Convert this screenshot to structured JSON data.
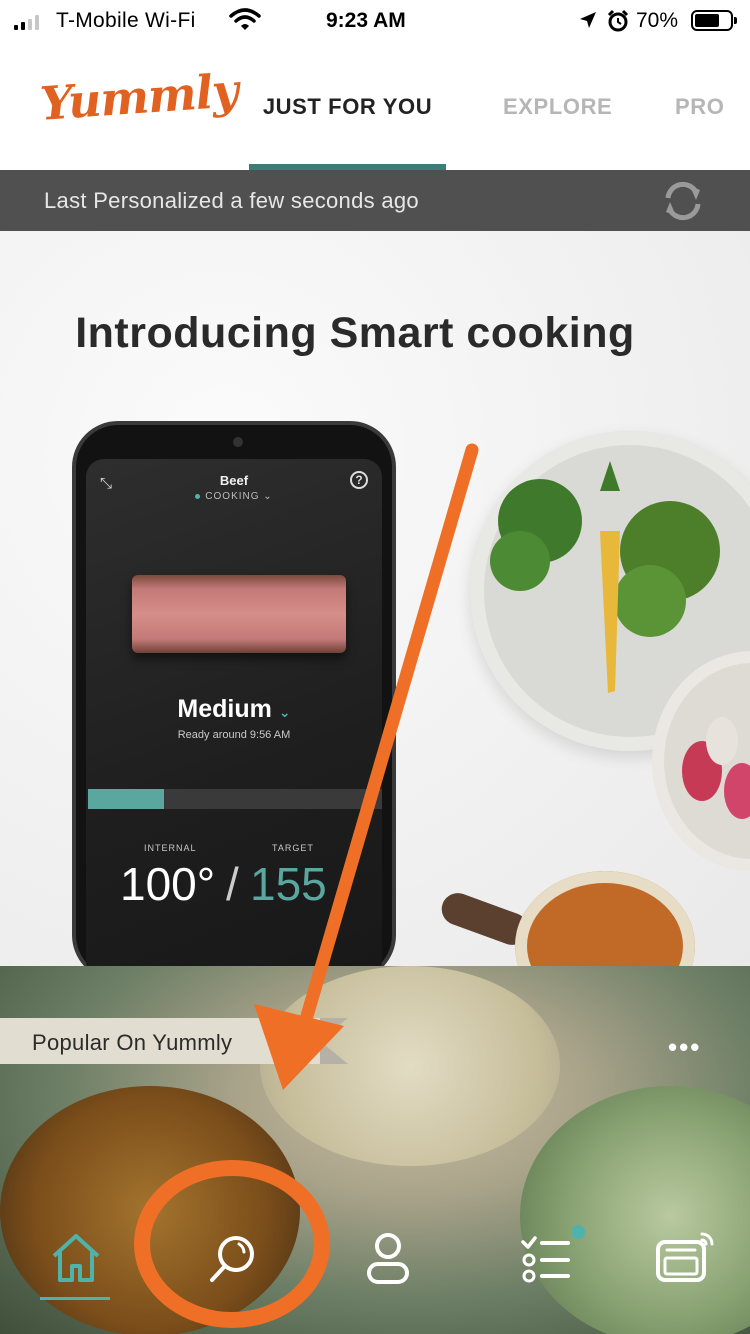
{
  "status_bar": {
    "carrier": "T-Mobile Wi-Fi",
    "time": "9:23 AM",
    "battery_percent": "70%",
    "battery_level": 0.7
  },
  "header": {
    "logo_text": "Yummly",
    "tabs": [
      {
        "label": "JUST FOR YOU",
        "active": true
      },
      {
        "label": "EXPLORE",
        "active": false
      },
      {
        "label": "PRO",
        "active": false
      }
    ]
  },
  "personalized_bar": {
    "text": "Last Personalized a few seconds ago"
  },
  "hero": {
    "title": "Introducing Smart cooking",
    "phone_screen": {
      "food": "Beef",
      "status": "COOKING",
      "doneness": "Medium",
      "ready_text": "Ready around 9:56 AM",
      "progress": 0.26,
      "internal_label": "INTERNAL",
      "target_label": "TARGET",
      "internal_temp": "100°",
      "target_temp": "155"
    }
  },
  "popular": {
    "label": "Popular On Yummly",
    "more_icon": "more-dots-icon"
  },
  "bottom_nav": {
    "items": [
      {
        "icon": "home-icon",
        "active": true
      },
      {
        "icon": "search-icon",
        "active": false
      },
      {
        "icon": "profile-icon",
        "active": false
      },
      {
        "icon": "shopping-list-icon",
        "active": false,
        "badge": true
      },
      {
        "icon": "smart-device-icon",
        "active": false
      }
    ]
  },
  "colors": {
    "brand": "#e16120",
    "accent": "#3f7b77",
    "teal_active": "#4fb3ab",
    "annotation": "#ef6f26"
  }
}
